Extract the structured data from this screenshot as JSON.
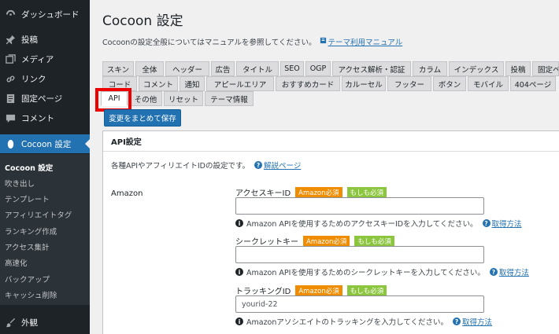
{
  "sidebar": {
    "items": [
      {
        "label": "ダッシュボード",
        "icon": "dashboard-icon"
      },
      {
        "label": "投稿",
        "icon": "pin-icon"
      },
      {
        "label": "メディア",
        "icon": "media-icon"
      },
      {
        "label": "リンク",
        "icon": "link-icon"
      },
      {
        "label": "固定ページ",
        "icon": "page-icon"
      },
      {
        "label": "コメント",
        "icon": "comment-icon"
      },
      {
        "label": "Cocoon 設定",
        "icon": "cocoon-icon"
      }
    ],
    "submenu": [
      "Cocoon 設定",
      "吹き出し",
      "テンプレート",
      "アフィリエイトタグ",
      "ランキング作成",
      "アクセス集計",
      "高速化",
      "バックアップ",
      "キャッシュ削除"
    ],
    "bottom": {
      "label": "外観",
      "icon": "appearance-icon"
    }
  },
  "page": {
    "title": "Cocoon 設定",
    "intro_text": "Cocoonの設定全般についてはマニュアルを参照してください。",
    "manual_link": "テーマ利用マニュアル"
  },
  "tabs": {
    "row1": [
      "スキン",
      "全体",
      "ヘッダー",
      "広告",
      "タイトル",
      "SEO",
      "OGP",
      "アクセス解析・認証",
      "カラム",
      "インデックス",
      "投稿",
      "固定ペ"
    ],
    "row2": [
      "コード",
      "コメント",
      "通知",
      "アピールエリア",
      "おすすめカード",
      "カルーセル",
      "フッター",
      "ボタン",
      "モバイル",
      "404ページ"
    ],
    "row3": [
      "API",
      "その他",
      "リセット",
      "テーマ情報"
    ],
    "active": "API"
  },
  "save_button": "変更をまとめて保存",
  "panel": {
    "title": "API設定",
    "description": "各種APIやアフィリエイトIDの設定です。",
    "description_link": "解説ページ",
    "section_label": "Amazon",
    "fields": [
      {
        "label": "アクセスキーID",
        "badge_required": "Amazon必須",
        "badge_optional": "もしも必須",
        "value": "",
        "help": "Amazon APIを使用するためのアクセスキーIDを入力してください。",
        "help_link": "取得方法"
      },
      {
        "label": "シークレットキー",
        "badge_required": "Amazon必須",
        "badge_optional": "もしも必須",
        "value": "",
        "help": "Amazon APIを使用するためのシークレットキーを入力してください。",
        "help_link": "取得方法"
      },
      {
        "label": "トラッキングID",
        "badge_required": "Amazon必須",
        "badge_optional": "もしも必須",
        "value": "yourid-22",
        "help": "Amazonアソシエイトのトラッキングを入力してください。",
        "help_link": "取得方法"
      }
    ]
  },
  "colors": {
    "accent": "#2271b1",
    "sidebar_bg": "#1d2327",
    "badge_required": "#f08c00",
    "badge_optional": "#8cc63f",
    "highlight": "#e00000"
  }
}
